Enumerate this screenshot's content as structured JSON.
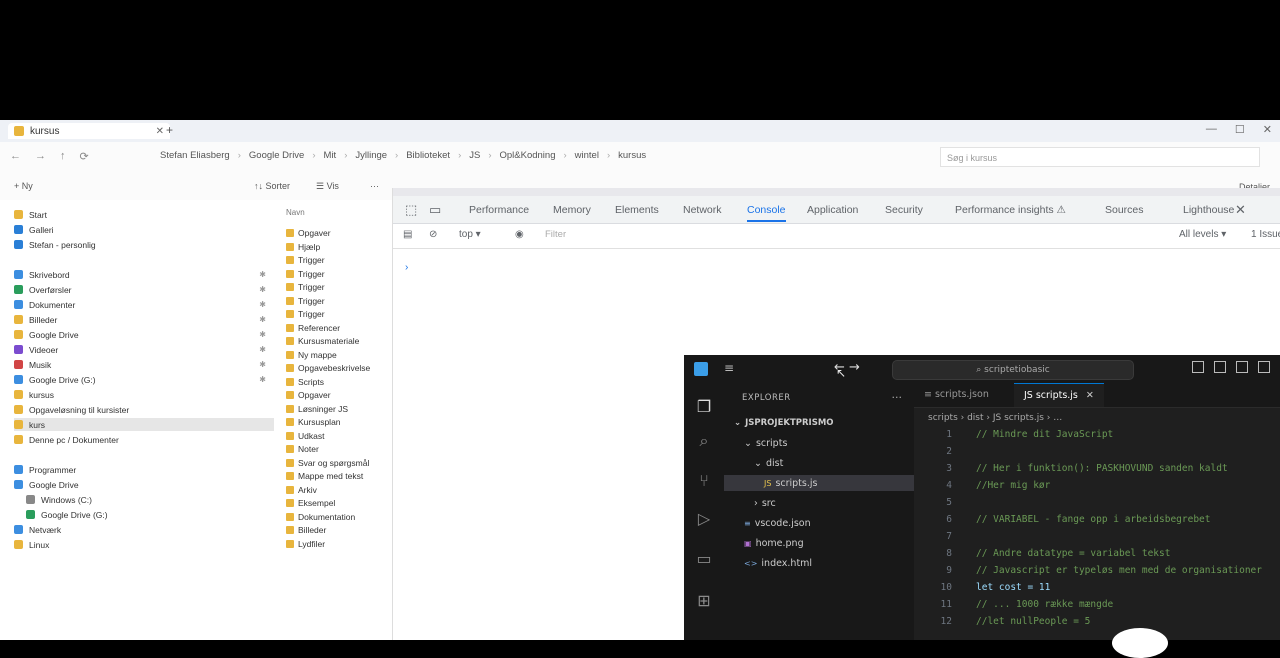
{
  "explorer": {
    "tab_title": "kursus",
    "tab_close": "✕",
    "new_tab": "+",
    "window_controls": [
      "—",
      "☐",
      "✕"
    ],
    "nav": [
      "←",
      "→",
      "↑",
      "⟳"
    ],
    "breadcrumbs": [
      "Stefan Eliasberg",
      "Google Drive",
      "Mit",
      "Jyllinge",
      "Biblioteket",
      "JS",
      "Opl&Kodning",
      "wintel",
      "kursus"
    ],
    "search_placeholder": "Søg i kursus",
    "toolbar": {
      "new": "+ Ny",
      "sort": "↑↓ Sorter",
      "view": "☰ Vis",
      "more": "···",
      "details": "Detaljer"
    },
    "sidebar": [
      {
        "label": "Start",
        "color": "#e8b53d"
      },
      {
        "label": "Galleri",
        "color": "#2a7fd6"
      },
      {
        "label": "Stefan - personlig",
        "color": "#2a7fd6"
      },
      {
        "label": "Skrivebord",
        "color": "#3c8ee0",
        "pin": true
      },
      {
        "label": "Overførsler",
        "color": "#2a9d5c",
        "pin": true
      },
      {
        "label": "Dokumenter",
        "color": "#3c8ee0",
        "pin": true
      },
      {
        "label": "Billeder",
        "color": "#e8b53d",
        "pin": true
      },
      {
        "label": "Google Drive",
        "color": "#e8b53d",
        "pin": true
      },
      {
        "label": "Videoer",
        "color": "#7b4ccf",
        "pin": true
      },
      {
        "label": "Musik",
        "color": "#d14545",
        "pin": true
      },
      {
        "label": "Google Drive (G:)",
        "color": "#3c8ee0",
        "pin": true
      },
      {
        "label": "kursus",
        "color": "#e8b53d"
      },
      {
        "label": "Opgaveløsning til kursister",
        "color": "#e8b53d"
      },
      {
        "label": "kurs",
        "color": "#e8b53d",
        "selected": true
      },
      {
        "label": "Denne pc / Dokumenter",
        "color": "#e8b53d"
      },
      {
        "label": "Programmer",
        "color": "#3c8ee0"
      },
      {
        "label": "Google Drive",
        "color": "#3c8ee0"
      },
      {
        "label": "Windows (C:)",
        "color": "#888888",
        "indent": true
      },
      {
        "label": "Google Drive (G:)",
        "color": "#2a9d5c",
        "indent": true
      },
      {
        "label": "Netværk",
        "color": "#3c8ee0"
      },
      {
        "label": "Linux",
        "color": "#e8b53d"
      }
    ],
    "files_header": "Navn",
    "files": [
      "Opgaver",
      "Hjælp",
      "Trigger",
      "Trigger",
      "Trigger",
      "Trigger",
      "Trigger",
      "Referencer",
      "Kursusmateriale",
      "Ny mappe",
      "Opgavebeskrivelse",
      "Scripts",
      "Opgaver",
      "Løsninger JS",
      "Kursusplan",
      "Udkast",
      "Noter",
      "Svar og spørgsmål",
      "Mappe med tekst",
      "Arkiv",
      "Eksempel",
      "Dokumentation",
      "Billeder",
      "Lydfiler"
    ]
  },
  "devtools": {
    "tabs": [
      "Performance",
      "Memory",
      "Elements",
      "Network",
      "Console",
      "Application",
      "Security",
      "Performance insights ⚠",
      "Sources",
      "Lighthouse"
    ],
    "active_tab": "Console",
    "close": "✕",
    "toolbar": {
      "context": "top ▾",
      "filter_placeholder": "Filter",
      "levels": "All levels ▾",
      "issues": "1 Issue"
    },
    "prompt": "›"
  },
  "vscode": {
    "menu": "≡",
    "nav": "← →",
    "command_center": "⌕ scriptetiobasic",
    "sidebar_title": "EXPLORER",
    "sidebar_more": "···",
    "tree": [
      {
        "label": "JSPROJEKTPRISMO",
        "bold": true,
        "indent": 0,
        "chevron": "⌄"
      },
      {
        "label": "scripts",
        "indent": 1,
        "chevron": "⌄"
      },
      {
        "label": "dist",
        "indent": 2,
        "chevron": "⌄"
      },
      {
        "label": "scripts.js",
        "indent": 3,
        "icon": "JS",
        "selected": true
      },
      {
        "label": "src",
        "indent": 2,
        "chevron": "›"
      },
      {
        "label": "vscode.json",
        "indent": 1,
        "icon": "≡"
      },
      {
        "label": "home.png",
        "indent": 1,
        "icon": "▣"
      },
      {
        "label": "index.html",
        "indent": 1,
        "icon": "<>"
      }
    ],
    "tabs": [
      {
        "label": "≡ scripts.json"
      },
      {
        "label": "JS scripts.js",
        "active": true,
        "close": "✕"
      }
    ],
    "breadcrumb": "scripts › dist › JS scripts.js › …",
    "code": [
      {
        "n": "1",
        "text": "// Mindre dit JavaScript",
        "cls": "c-comment"
      },
      {
        "n": "2",
        "text": "",
        "cls": "c-plain"
      },
      {
        "n": "3",
        "text": "// Her i funktion(): PASKHOVUND sanden kaldt",
        "cls": "c-comment"
      },
      {
        "n": "4",
        "text": "//Her mig kør",
        "cls": "c-comment"
      },
      {
        "n": "5",
        "text": "",
        "cls": "c-plain"
      },
      {
        "n": "6",
        "text": "// VARIABEL - fange opp i arbeidsbegrebet",
        "cls": "c-comment"
      },
      {
        "n": "7",
        "text": "",
        "cls": "c-plain"
      },
      {
        "n": "8",
        "text": "// Andre datatype = variabel tekst",
        "cls": "c-comment"
      },
      {
        "n": "9",
        "text": "// Javascript er typeløs men med de organisationer",
        "cls": "c-comment"
      },
      {
        "n": "10",
        "text": "let cost = 11",
        "cls": "c-var"
      },
      {
        "n": "11",
        "text": "// ... 1000 række mængde",
        "cls": "c-comment"
      },
      {
        "n": "12",
        "text": "//let nullPeople = 5",
        "cls": "c-comment"
      }
    ]
  },
  "cursor": "↖"
}
